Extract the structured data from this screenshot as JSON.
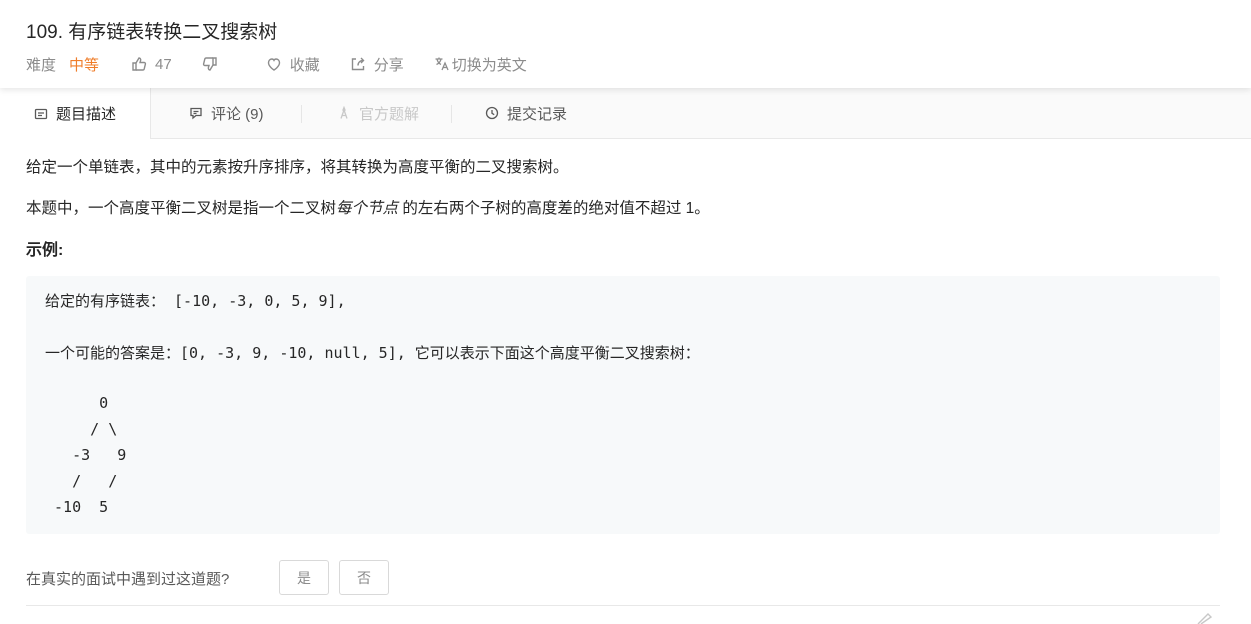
{
  "header": {
    "title": "109. 有序链表转换二叉搜索树",
    "difficulty_label": "难度",
    "difficulty_value": "中等",
    "likes": "47",
    "favorite_label": "收藏",
    "share_label": "分享",
    "switch_lang_label": "切换为英文"
  },
  "tabs": [
    {
      "label": "题目描述",
      "icon": "description-icon",
      "active": true
    },
    {
      "label": "评论 (9)",
      "icon": "comment-icon"
    },
    {
      "label": "官方题解",
      "icon": "solution-icon",
      "disabled": true
    },
    {
      "label": "提交记录",
      "icon": "clock-icon"
    }
  ],
  "description": {
    "p1": "给定一个单链表，其中的元素按升序排序，将其转换为高度平衡的二叉搜索树。",
    "p2_before": "本题中，一个高度平衡二叉树是指一个二叉树",
    "p2_em": "每个节点",
    "p2_after": " 的左右两个子树的高度差的绝对值不超过 1。",
    "example_heading": "示例:"
  },
  "example_code": [
    "给定的有序链表： [-10, -3, 0, 5, 9],",
    "",
    "一个可能的答案是：[0, -3, 9, -10, null, 5], 它可以表示下面这个高度平衡二叉搜索树：",
    "",
    "      0",
    "     / \\",
    "   -3   9",
    "   /   /",
    " -10  5"
  ],
  "feedback": {
    "question": "在真实的面试中遇到过这道题?",
    "yes": "是",
    "no": "否"
  },
  "colors": {
    "difficulty_medium": "#ef7d2a",
    "code_background": "#f7f9fa",
    "tab_bar_background": "#fafafa"
  }
}
